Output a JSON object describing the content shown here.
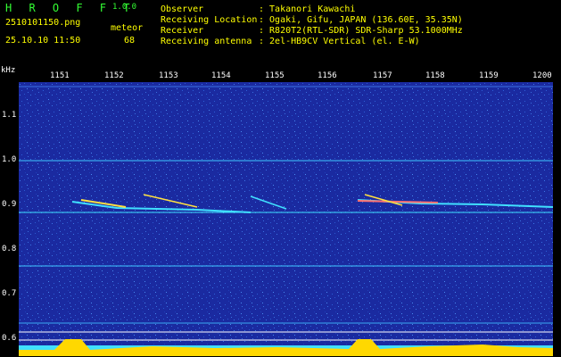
{
  "header": {
    "app_title": "H R O F F T",
    "app_version": "1.0.0",
    "filename": "2510101150.png",
    "datetime": "25.10.10 11:50",
    "meteor_label": "meteor",
    "meteor_count": "68"
  },
  "info": [
    {
      "key": "Observer",
      "value": ": Takanori Kawachi"
    },
    {
      "key": "Receiving Location",
      "value": ": Ogaki, Gifu, JAPAN (136.60E, 35.35N)"
    },
    {
      "key": "Receiver",
      "value": ": R820T2(RTL-SDR) SDR-Sharp 53.1000MHz"
    },
    {
      "key": "Receiving antenna",
      "value": ": 2el-HB9CV Vertical (el. E-W)"
    }
  ],
  "axis": {
    "unit": "kHz",
    "minutes": [
      "1151",
      "1152",
      "1153",
      "1154",
      "1155",
      "1156",
      "1157",
      "1158",
      "1159",
      "1200"
    ],
    "freqs": [
      "1.1",
      "1.0",
      "0.9",
      "0.8",
      "0.7",
      "0.6"
    ]
  },
  "colors": {
    "background": "#1a2aa0",
    "label_green": "#33ff33",
    "label_yellow": "#ffff00",
    "signal_cyan": "#40e0ff",
    "signal_yellow": "#ffd800"
  }
}
